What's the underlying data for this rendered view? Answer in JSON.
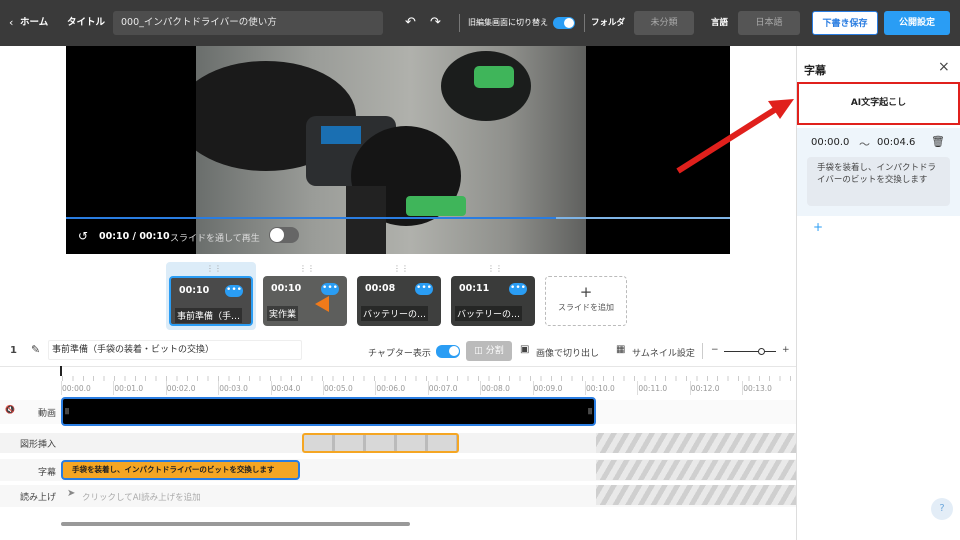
{
  "topbar": {
    "back_label": "ホーム",
    "title_label": "タイトル",
    "title_value": "000_インパクトドライバーの使い方",
    "old_editor_label": "旧編集画面に切り替え",
    "folder_label": "フォルダ",
    "folder_value": "未分類",
    "language_label": "言語",
    "language_value": "日本語",
    "save_draft_label": "下書き保存",
    "publish_label": "公開設定"
  },
  "video": {
    "time_display": "00:10 / 00:10",
    "play_through_label": "スライドを通して再生"
  },
  "slides": [
    {
      "time": "00:10",
      "label": "事前準備（手…"
    },
    {
      "time": "00:10",
      "label": "実作業"
    },
    {
      "time": "00:08",
      "label": "バッテリーの…"
    },
    {
      "time": "00:11",
      "label": "バッテリーの…"
    }
  ],
  "add_slide_label": "スライドを追加",
  "toolbar": {
    "slide_number": "1",
    "slide_title": "事前準備（手袋の装着・ビットの交換）",
    "chapter_label": "チャプター表示",
    "split_label": "分割",
    "crop_label": "画像で切り出し",
    "thumbnail_label": "サムネイル設定",
    "zoom_minus": "−",
    "zoom_plus": "+"
  },
  "timeline": {
    "ticks": [
      "00:00.0",
      "00:01.0",
      "00:02.0",
      "00:03.0",
      "00:04.0",
      "00:05.0",
      "00:06.0",
      "00:07.0",
      "00:08.0",
      "00:09.0",
      "00:10.0",
      "00:11.0",
      "00:12.0",
      "00:13.0"
    ],
    "track_video": "動画",
    "track_shape": "図形挿入",
    "track_subtitle": "字幕",
    "track_narration": "読み上げ",
    "subtitle_clip": "手袋を装着し、インパクトドライバーのビットを交換します",
    "narration_placeholder": "クリックしてAI読み上げを追加"
  },
  "panel": {
    "title": "字幕",
    "ai_button": "AI文字起こし",
    "start_time": "00:00.0",
    "tilde": "〜",
    "end_time": "00:04.6",
    "subtitle_text": "手袋を装着し、インパクトドライバーのビットを交換します",
    "add_symbol": "+",
    "help": "?"
  },
  "colors": {
    "accent": "#2a9df4",
    "highlight_red": "#e0201c",
    "clip_orange": "#f5a623",
    "topbar": "#3a3a3a"
  }
}
